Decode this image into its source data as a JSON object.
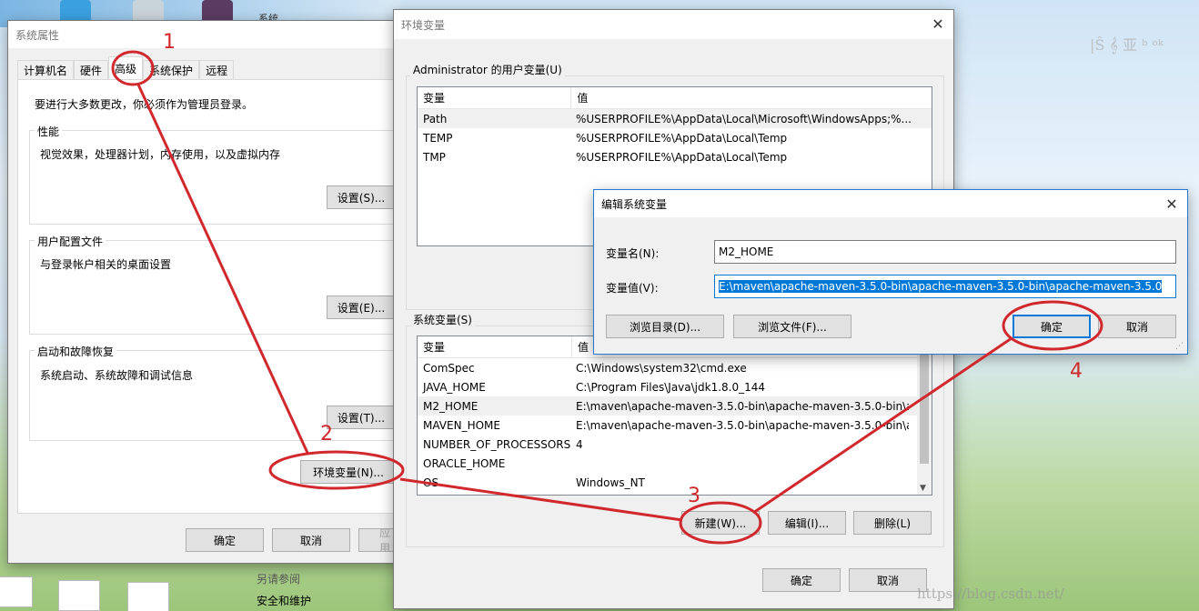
{
  "desktop": {
    "top_label": "系统",
    "side_items": [
      "另请参阅",
      "安全和维护"
    ],
    "watermark_top": "|Ŝ 𝄞 亚 ᵇ ᵒᵏ",
    "watermark_bottom": "https://blog.csdn.net/"
  },
  "sys_props": {
    "title": "系统属性",
    "tabs": [
      "计算机名",
      "硬件",
      "高级",
      "系统保护",
      "远程"
    ],
    "admin_note": "要进行大多数更改，你必须作为管理员登录。",
    "performance": {
      "label": "性能",
      "desc": "视觉效果，处理器计划，内存使用，以及虚拟内存",
      "button": "设置(S)..."
    },
    "profiles": {
      "label": "用户配置文件",
      "desc": "与登录帐户相关的桌面设置",
      "button": "设置(E)..."
    },
    "startup": {
      "label": "启动和故障恢复",
      "desc": "系统启动、系统故障和调试信息",
      "button": "设置(T)..."
    },
    "env_button": "环境变量(N)...",
    "ok": "确定",
    "cancel": "取消",
    "apply": "应用"
  },
  "env_vars": {
    "title": "环境变量",
    "user_group": "Administrator 的用户变量(U)",
    "col_var": "变量",
    "col_val": "值",
    "user_rows": [
      {
        "name": "Path",
        "value": "%USERPROFILE%\\AppData\\Local\\Microsoft\\WindowsApps;%..."
      },
      {
        "name": "TEMP",
        "value": "%USERPROFILE%\\AppData\\Local\\Temp"
      },
      {
        "name": "TMP",
        "value": "%USERPROFILE%\\AppData\\Local\\Temp"
      }
    ],
    "sys_group": "系统变量(S)",
    "sys_rows": [
      {
        "name": "ComSpec",
        "value": "C:\\Windows\\system32\\cmd.exe"
      },
      {
        "name": "JAVA_HOME",
        "value": "C:\\Program Files\\Java\\jdk1.8.0_144"
      },
      {
        "name": "M2_HOME",
        "value": "E:\\maven\\apache-maven-3.5.0-bin\\apache-maven-3.5.0-bin\\a..."
      },
      {
        "name": "MAVEN_HOME",
        "value": "E:\\maven\\apache-maven-3.5.0-bin\\apache-maven-3.5.0-bin\\a..."
      },
      {
        "name": "NUMBER_OF_PROCESSORS",
        "value": "4"
      },
      {
        "name": "ORACLE_HOME",
        "value": ""
      },
      {
        "name": "OS",
        "value": "Windows_NT"
      }
    ],
    "new_button": "新建(W)...",
    "edit_button": "编辑(I)...",
    "delete_button": "删除(L)",
    "ok": "确定",
    "cancel": "取消"
  },
  "edit_dialog": {
    "title": "编辑系统变量",
    "name_label": "变量名(N):",
    "name_value": "M2_HOME",
    "value_label": "变量值(V):",
    "value_value": "E:\\maven\\apache-maven-3.5.0-bin\\apache-maven-3.5.0-bin\\apache-maven-3.5.0",
    "browse_dir": "浏览目录(D)...",
    "browse_file": "浏览文件(F)...",
    "ok": "确定",
    "cancel": "取消"
  },
  "annotations": [
    "1",
    "2",
    "3",
    "4"
  ],
  "colors": {
    "annotation_red": "#d0282d",
    "selection_blue": "#0078d7"
  }
}
